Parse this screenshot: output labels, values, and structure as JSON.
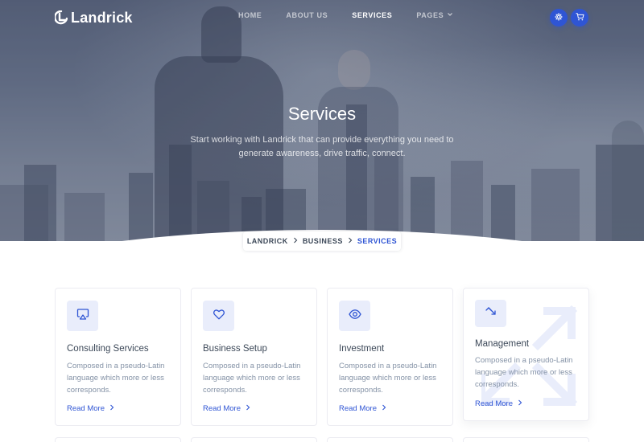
{
  "brand": {
    "name": "Landrick"
  },
  "nav": {
    "items": [
      {
        "label": "HOME",
        "active": false
      },
      {
        "label": "ABOUT US",
        "active": false
      },
      {
        "label": "SERVICES",
        "active": true
      },
      {
        "label": "PAGES",
        "active": false,
        "has_dropdown": true
      }
    ],
    "buttons": [
      {
        "icon": "gear-icon"
      },
      {
        "icon": "cart-icon"
      }
    ]
  },
  "hero": {
    "title": "Services",
    "subtitle": "Start working with Landrick that can provide everything you need to generate awareness, drive traffic, connect."
  },
  "breadcrumb": {
    "items": [
      "LANDRICK",
      "BUSINESS",
      "SERVICES"
    ]
  },
  "services": [
    {
      "title": "Consulting Services",
      "description": "Composed in a pseudo-Latin language which more or less corresponds.",
      "link": "Read More",
      "icon": "airplay-icon"
    },
    {
      "title": "Business Setup",
      "description": "Composed in a pseudo-Latin language which more or less corresponds.",
      "link": "Read More",
      "icon": "heart-icon"
    },
    {
      "title": "Investment",
      "description": "Composed in a pseudo-Latin language which more or less corresponds.",
      "link": "Read More",
      "icon": "eye-icon"
    },
    {
      "title": "Management",
      "description": "Composed in a pseudo-Latin language which more or less corresponds.",
      "link": "Read More",
      "icon": "maximize-arrows-icon"
    }
  ],
  "colors": {
    "primary": "#2f55d4",
    "heading": "#3c4858",
    "muted": "#8492a6",
    "icon_bg": "#e9edfb"
  }
}
